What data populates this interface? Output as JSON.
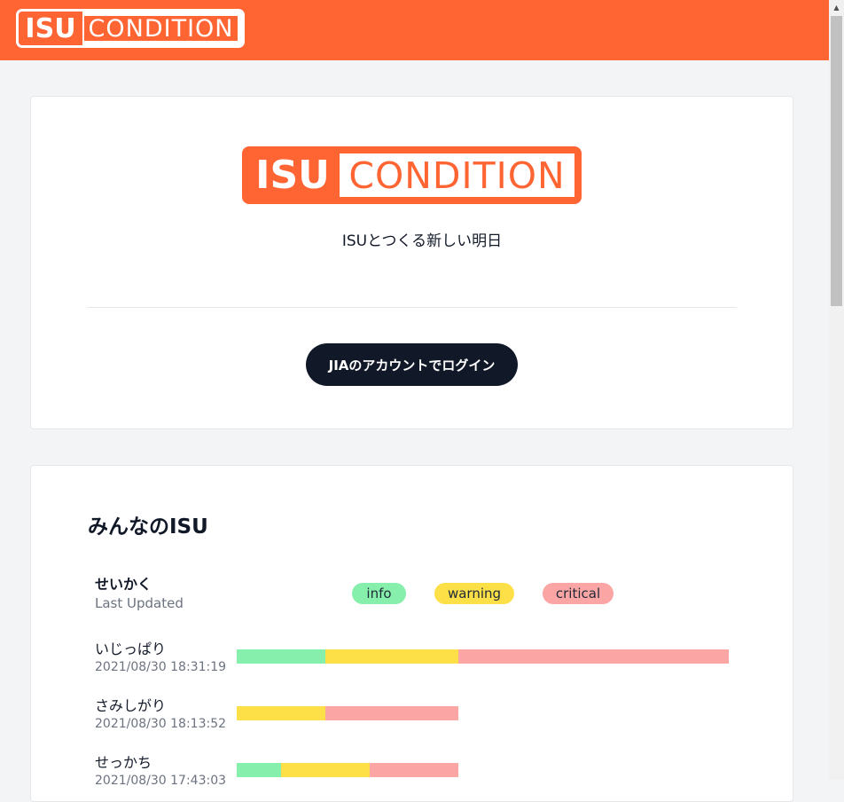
{
  "header": {
    "logo": {
      "isu": "ISU",
      "condition": "CONDITION"
    }
  },
  "hero": {
    "logo": {
      "isu": "ISU",
      "condition": "CONDITION"
    },
    "tagline": "ISUとつくる新しい明日",
    "login_label": "JIAのアカウントでログイン"
  },
  "isu_list": {
    "title": "みんなのISU",
    "header": {
      "name": "せいかく",
      "updated": "Last Updated",
      "legend": {
        "info": "info",
        "warning": "warning",
        "critical": "critical"
      }
    },
    "rows": [
      {
        "name": "いじっぱり",
        "time": "2021/08/30 18:31:19",
        "info": 2,
        "warning": 3,
        "critical": 6
      },
      {
        "name": "さみしがり",
        "time": "2021/08/30 18:13:52",
        "info": 0,
        "warning": 2,
        "critical": 3
      },
      {
        "name": "せっかち",
        "time": "2021/08/30 17:43:03",
        "info": 1,
        "warning": 2,
        "critical": 2
      }
    ]
  },
  "colors": {
    "brand": "#ff6433",
    "info": "#86efac",
    "warning": "#fde047",
    "critical": "#fca5a5",
    "button": "#111827"
  }
}
